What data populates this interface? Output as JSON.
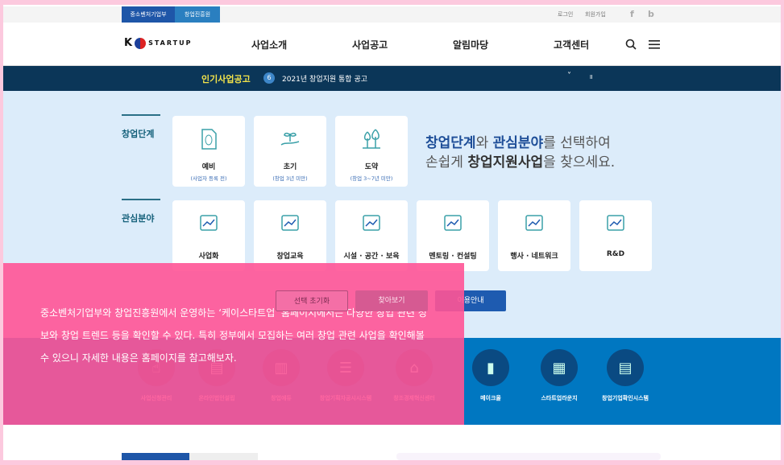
{
  "util": {
    "tabs": [
      "중소벤처기업부",
      "창업진흥원"
    ],
    "login": "로그인",
    "join": "회원가입",
    "social": [
      "f",
      "b"
    ]
  },
  "header": {
    "logo_k": "K",
    "logo_text": "STARTUP",
    "nav": [
      "사업소개",
      "사업공고",
      "알림마당",
      "고객센터"
    ],
    "icons": [
      "search-icon",
      "menu-icon"
    ]
  },
  "ticker": {
    "label": "인기사업공고",
    "num": "6",
    "text": "2021년 창업지원 통합 공고",
    "controls": [
      "˅",
      "॥"
    ]
  },
  "stage": {
    "title": "창업단계",
    "cards": [
      {
        "label": "예비",
        "sub": "(사업자 등록 전)"
      },
      {
        "label": "초기",
        "sub": "(창업 3년 미만)"
      },
      {
        "label": "도약",
        "sub": "(창업 3~7년 미만)"
      }
    ]
  },
  "headline": {
    "b1": "창업단계",
    "t1": "와 ",
    "b2": "관심분야",
    "t2": "를 선택하여",
    "t3": "손쉽게 ",
    "b3": "창업지원사업",
    "t4": "을 찾으세요."
  },
  "interest": {
    "title": "관심분야",
    "cards": [
      "사업화",
      "창업교육",
      "시설 · 공간 · 보육",
      "멘토링 · 컨설팅",
      "행사 · 네트워크",
      "R&D"
    ]
  },
  "buttons": {
    "reset": "선택 초기화",
    "search": "찾아보기",
    "guide": "이용안내"
  },
  "services": [
    "사업신청관리",
    "온라인법인설립",
    "창업에듀",
    "창업기획자공시시스템",
    "창조경제혁신센터",
    "메이크올",
    "스타트업라운지",
    "창업기업확인시스템"
  ],
  "overlay": {
    "text": "중소벤처기업부와 창업진흥원에서 운영하는 ‘케이스타트업’ 홈페이지에서는 다양한 창업 관련 정보와 창업 트렌드 등을 확인할 수 있다. 특히 정부에서 모집하는 여러 창업 관련 사업을 확인해볼 수 있으니 자세한 내용은 홈페이지를 참고해보자."
  },
  "colors": {
    "navy": "#0b3658",
    "accent": "#1e5bb0",
    "band": "#0077c1",
    "overlay": "#ff5496",
    "ticker_label": "#f2e34a"
  }
}
